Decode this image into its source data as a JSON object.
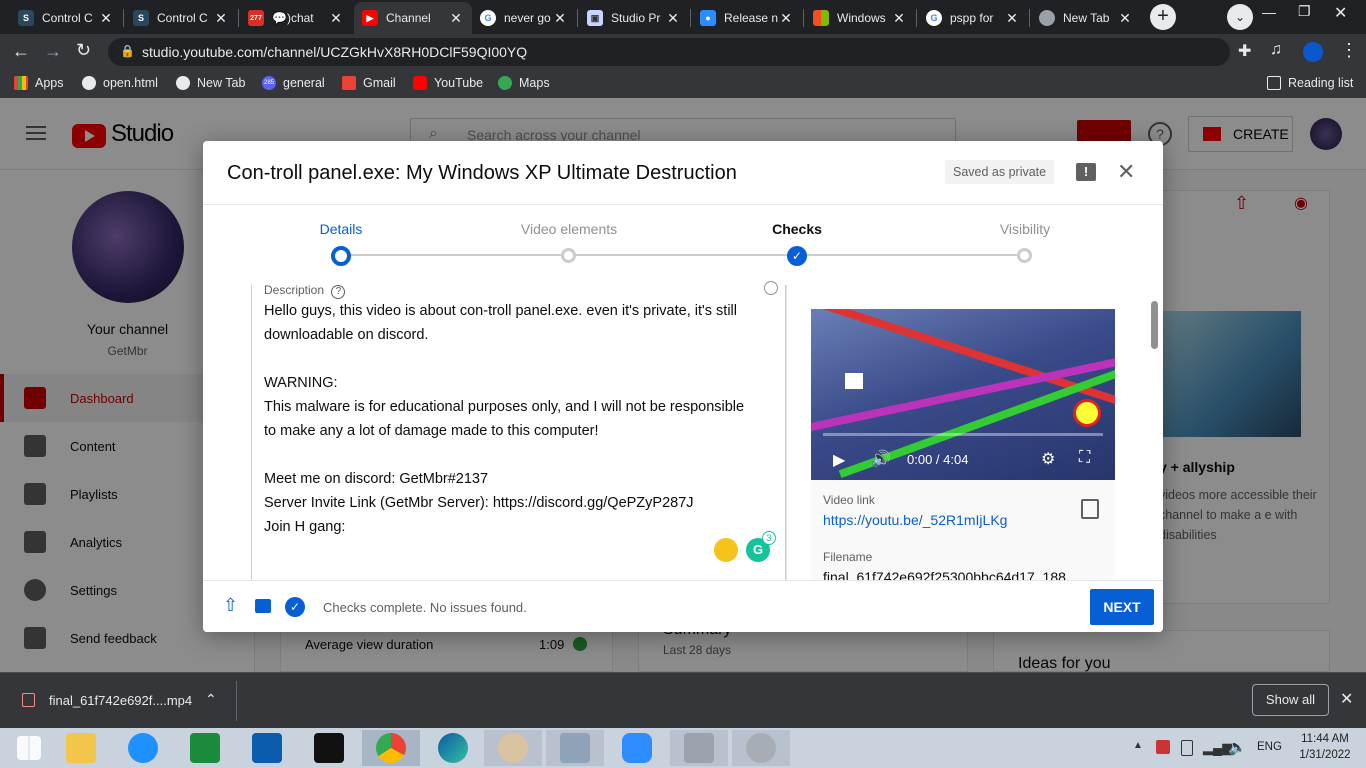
{
  "browser": {
    "tabs": [
      {
        "label": "Control C",
        "icon": "steam-icon"
      },
      {
        "label": "Control C",
        "icon": "steam-icon"
      },
      {
        "label": "💬)chat",
        "icon": "discord-icon",
        "badge": "277"
      },
      {
        "label": "Channel",
        "icon": "youtube-icon"
      },
      {
        "label": "never go",
        "icon": "google-icon"
      },
      {
        "label": "Studio Pr",
        "icon": "studio-icon"
      },
      {
        "label": "Release n",
        "icon": "zoom-icon"
      },
      {
        "label": "Windows",
        "icon": "microsoft-icon"
      },
      {
        "label": "pspp for",
        "icon": "google-icon"
      },
      {
        "label": "New Tab",
        "icon": "chrome-icon"
      }
    ],
    "url": "studio.youtube.com/channel/UCZGkHvX8RH0DClF59QI00YQ",
    "bookmarks": [
      "Apps",
      "open.html",
      "New Tab",
      "general",
      "Gmail",
      "YouTube",
      "Maps"
    ],
    "bookmark_badge": "285",
    "reading_list": "Reading list"
  },
  "studio": {
    "logo_text": "Studio",
    "search_placeholder": "Search across your channel",
    "create_label": "CREATE",
    "channel_title": "Your channel",
    "channel_name": "GetMbr",
    "nav": [
      "Dashboard",
      "Content",
      "Playlists",
      "Analytics",
      "Settings",
      "Send feedback"
    ],
    "behind": {
      "avg_view_label": "Average view duration",
      "avg_view_value": "1:09",
      "summary_label": "Summary",
      "summary_sub": "Last 28 days",
      "ideas_label": "Ideas for you",
      "promo_title": "y + allyship",
      "promo_text": "videos more accessible their channel to make a e with disabilities"
    }
  },
  "dialog": {
    "title": "Con-troll panel.exe: My Windows XP Ultimate Destruction",
    "saved_badge": "Saved as private",
    "steps": [
      "Details",
      "Video elements",
      "Checks",
      "Visibility"
    ],
    "description_label": "Description",
    "description_lines": [
      "Hello guys, this video is about con-troll panel.exe. even it's private, it's still",
      "downloadable on discord.",
      "",
      "WARNING:",
      "This malware is for educational purposes only, and I will not be responsible",
      "to make any a lot of damage made to this computer!",
      "",
      "Meet me on discord: GetMbr#2137",
      "Server Invite Link (GetMbr Server): https://discord.gg/QePZyP287J",
      "Join H gang:"
    ],
    "grammarly_count": "3",
    "player_time": "0:00 / 4:04",
    "video_link_label": "Video link",
    "video_link": "https://youtu.be/_52R1mIjLKg",
    "filename_label": "Filename",
    "filename": "final_61f742e692f25300bbc64d17_188",
    "status": "Checks complete. No issues found.",
    "next_label": "NEXT"
  },
  "downloads": {
    "file": "final_61f742e692f....mp4",
    "show_all": "Show all"
  },
  "taskbar": {
    "lang": "ENG",
    "time": "11:44 AM",
    "date": "1/31/2022"
  },
  "colors": {
    "accent": "#065fd4",
    "youtube_red": "#ff0000",
    "chrome_dark": "#35363a"
  }
}
